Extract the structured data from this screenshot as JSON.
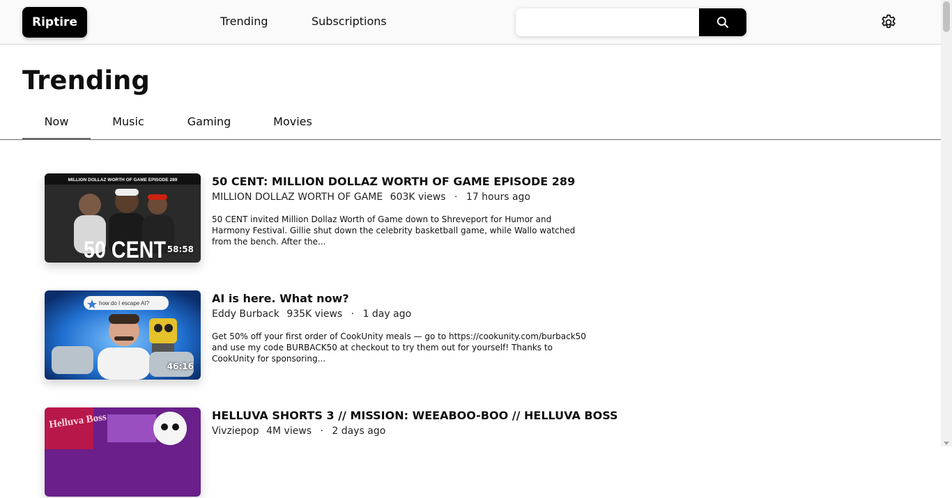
{
  "header": {
    "logo": "Riptire",
    "nav": [
      {
        "label": "Trending"
      },
      {
        "label": "Subscriptions"
      }
    ],
    "search": {
      "value": "",
      "placeholder": ""
    },
    "icons": {
      "search": "search-icon",
      "settings": "gear-icon"
    }
  },
  "page": {
    "title": "Trending",
    "tabs": [
      {
        "label": "Now",
        "active": true
      },
      {
        "label": "Music",
        "active": false
      },
      {
        "label": "Gaming",
        "active": false
      },
      {
        "label": "Movies",
        "active": false
      }
    ]
  },
  "videos": [
    {
      "title": "50 CENT: MILLION DOLLAZ WORTH OF GAME EPISODE 289",
      "channel": "MILLION DOLLAZ WORTH OF GAME",
      "views": "603K views",
      "age": "17 hours ago",
      "duration": "58:58",
      "description": "50 CENT invited Million Dollaz Worth of Game down to Shreveport for Humor and Harmony Festival. Gillie shut down the celebrity basketball game, while Wallo watched from the bench. After the...",
      "thumb_text": "50 CENT",
      "thumb_banner": "MILLION DOLLAZ WORTH OF GAME EPISODE 289"
    },
    {
      "title": "AI is here. What now?",
      "channel": "Eddy Burback",
      "views": "935K views",
      "age": "1 day ago",
      "duration": "46:16",
      "description": "Get 50% off your first order of CookUnity meals — go to https://cookunity.com/burback50 and use my code BURBACK50 at checkout to try them out for yourself! Thanks to CookUnity for sponsoring...",
      "thumb_text": "how do I escape AI?"
    },
    {
      "title": "HELLUVA SHORTS 3 // MISSION: WEEABOO-BOO // HELLUVA BOSS",
      "channel": "Vivziepop",
      "views": "4M views",
      "age": "2 days ago",
      "duration": "",
      "description": "",
      "thumb_text": "Helluva Boss"
    }
  ],
  "separator": "·"
}
